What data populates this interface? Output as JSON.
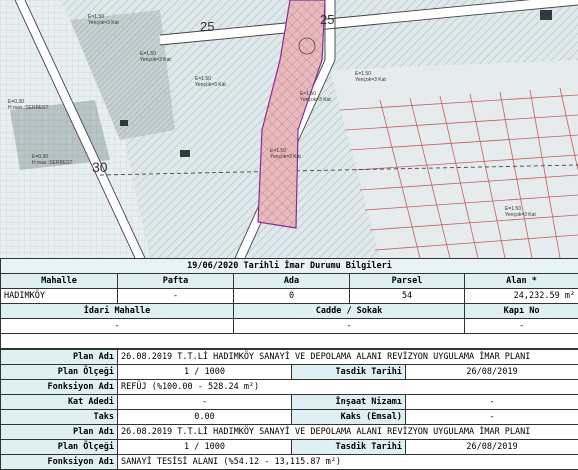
{
  "map": {
    "road_label_top": "25",
    "road_label_top_right": "25",
    "road_label_left": "30",
    "parcel_labels": [
      {
        "line1": "E=1.50",
        "line2": "Yençok=3 Kat"
      },
      {
        "line1": "E=1.50",
        "line2": "Yençok=3 Kat"
      },
      {
        "line1": "E=1.50",
        "line2": "Yençok=3 Kat"
      },
      {
        "line1": "E=1.50",
        "line2": "Yençok=3 Kat"
      },
      {
        "line1": "E=0.30",
        "line2": "H max.:SERBEST"
      },
      {
        "line1": "E=0.30",
        "line2": "H max.:SERBEST"
      },
      {
        "line1": "E=1.50",
        "line2": "Yençok=3 Kat"
      },
      {
        "line1": "E=1.50",
        "line2": "Yençok=3 Kat"
      },
      {
        "line1": "E=1.50",
        "line2": "Yençok=3 Kat"
      }
    ]
  },
  "info": {
    "title": "19/06/2020 Tarihli İmar Durumu Bilgileri",
    "headers1": [
      "Mahalle",
      "Pafta",
      "Ada",
      "Parsel",
      "Alan *"
    ],
    "values1": [
      "HADIMKÖY",
      "-",
      "0",
      "54",
      "24,232.59 m²"
    ],
    "headers2": [
      "İdari Mahalle",
      "Cadde / Sokak",
      "Kapı No"
    ],
    "values2": [
      "-",
      "-",
      "-"
    ],
    "block1": {
      "plan_adi_label": "Plan Adı",
      "plan_adi": "26.08.2019 T.T.Lİ HADIMKÖY SANAYİ VE DEPOLAMA ALANI REVİZYON UYGULAMA İMAR PLANI",
      "plan_olcegi_label": "Plan Ölçeği",
      "plan_olcegi": "1 / 1000",
      "tasdik_label": "Tasdik Tarihi",
      "tasdik": "26/08/2019",
      "fonksiyon_label": "Fonksiyon Adı",
      "fonksiyon": "REFÜJ (%100.00 - 528.24 m²)",
      "kat_label": "Kat Adedi",
      "kat": "-",
      "insaat_label": "İnşaat Nizamı",
      "insaat": "-",
      "taks_label": "Taks",
      "taks": "0.00",
      "kaks_label": "Kaks (Emsal)",
      "kaks": "-"
    },
    "block2": {
      "plan_adi_label": "Plan Adı",
      "plan_adi": "26.08.2019 T.T.Lİ HADIMKÖY SANAYİ VE DEPOLAMA ALANI REVİZYON UYGULAMA İMAR PLANI",
      "plan_olcegi_label": "Plan Ölçeği",
      "plan_olcegi": "1 / 1000",
      "tasdik_label": "Tasdik Tarihi",
      "tasdik": "26/08/2019",
      "fonksiyon_label": "Fonksiyon Adı",
      "fonksiyon": "SANAYİ TESİSİ ALANI (%54.12 - 13,115.87 m²)"
    }
  }
}
